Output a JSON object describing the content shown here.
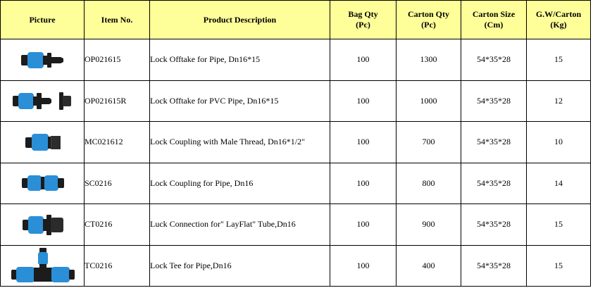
{
  "headers": {
    "picture": "Picture",
    "item_no": "Item No.",
    "description": "Product Description",
    "bag_qty": "Bag Qty",
    "bag_qty_unit": "(Pc)",
    "carton_qty": "Carton Qty",
    "carton_qty_unit": "(Pc)",
    "carton_size": "Carton Size",
    "carton_size_unit": "(Cm)",
    "gw": "G.W/Carton",
    "gw_unit": "(Kg)"
  },
  "colors": {
    "header_bg": "#ffff99",
    "fitting_blue": "#2a8fd6",
    "fitting_black": "#1c1c1c"
  },
  "rows": [
    {
      "picture_icon": "lock-offtake-fitting-icon",
      "item_no": "OP021615",
      "description": "Lock Offtake for  Pipe, Dn16*15",
      "bag_qty": "100",
      "carton_qty": "1300",
      "carton_size": "54*35*28",
      "gw": "15"
    },
    {
      "picture_icon": "lock-offtake-pvc-fitting-icon",
      "item_no": "OP021615R",
      "description": "Lock Offtake for PVC Pipe, Dn16*15",
      "bag_qty": "100",
      "carton_qty": "1000",
      "carton_size": "54*35*28",
      "gw": "12"
    },
    {
      "picture_icon": "lock-coupling-male-thread-icon",
      "item_no": "MC021612",
      "description": "Lock Coupling with Male Thread,  Dn16*1/2\"",
      "bag_qty": "100",
      "carton_qty": "700",
      "carton_size": "54*35*28",
      "gw": "10"
    },
    {
      "picture_icon": "lock-coupling-icon",
      "item_no": "SC0216",
      "description": "Lock Coupling for Pipe, Dn16",
      "bag_qty": "100",
      "carton_qty": "800",
      "carton_size": "54*35*28",
      "gw": "14"
    },
    {
      "picture_icon": "layflat-connection-icon",
      "item_no": "CT0216",
      "description": "Luck Connection for\" LayFlat\"  Tube,Dn16",
      "bag_qty": "100",
      "carton_qty": "900",
      "carton_size": "54*35*28",
      "gw": "15"
    },
    {
      "picture_icon": "lock-tee-icon",
      "item_no": "TC0216",
      "description": "Lock Tee for Pipe,Dn16",
      "bag_qty": "100",
      "carton_qty": "400",
      "carton_size": "54*35*28",
      "gw": "15"
    }
  ]
}
